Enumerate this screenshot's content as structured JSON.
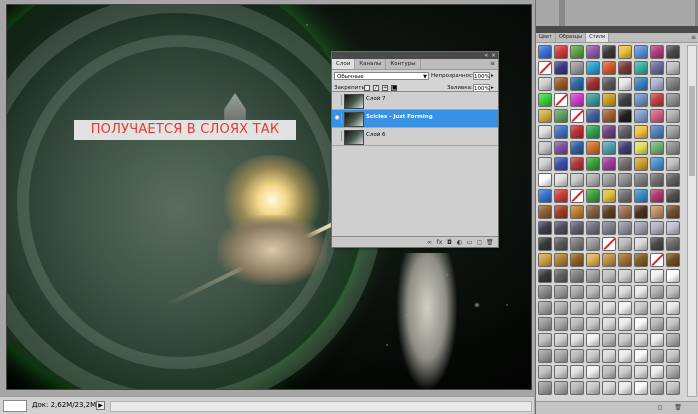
{
  "document": {
    "caption": "ПОЛУЧАЕТСЯ В СЛОЯХ ТАК"
  },
  "status_bar": {
    "doc_size": "Док: 2,62M/23,2M",
    "arrow": "▶"
  },
  "layers_panel": {
    "tabs": [
      {
        "label": "Слои",
        "active": true
      },
      {
        "label": "Каналы",
        "active": false
      },
      {
        "label": "Контуры",
        "active": false
      }
    ],
    "blend_mode": "Обычные",
    "opacity_label": "Непрозрачность:",
    "opacity_value": "100%",
    "lock_label": "Закрепить:",
    "fill_label": "Заливка:",
    "fill_value": "100%",
    "layers": [
      {
        "name": "Слой 7",
        "selected": false,
        "visible": false
      },
      {
        "name": "Scicles - Just Forming",
        "selected": true,
        "visible": true
      },
      {
        "name": "Слой 6",
        "selected": false,
        "visible": false
      }
    ],
    "bottom_icons": [
      "link-icon",
      "fx-icon",
      "mask-icon",
      "adjustment-icon",
      "folder-icon",
      "new-layer-icon",
      "trash-icon"
    ]
  },
  "styles_panel": {
    "tabs": [
      {
        "label": "Цвет",
        "active": false
      },
      {
        "label": "Образцы",
        "active": false
      },
      {
        "label": "Стили",
        "active": true
      }
    ],
    "swatches": [
      "#3a6fd8",
      "#d23a3a",
      "#5fa04a",
      "#8d5aa6",
      "#3a3a3a",
      "#e6c23a",
      "#5a8fd8",
      "#b53a7a",
      "#4a4a4a",
      "#none",
      "#3a3a8a",
      "#9a9a9a",
      "#2aa0d0",
      "#d85a2a",
      "#7a3a3a",
      "#3ab0a0",
      "#6a6a9a",
      "#c0c0c0",
      "#d2d2d2",
      "#9a5a2a",
      "#2a6aa6",
      "#a03030",
      "#5a5a5a",
      "#e8e8e8",
      "#3a80c0",
      "#b0b0d0",
      "#808080",
      "#3ad03a",
      "#none",
      "#d03ad0",
      "#3a9a9a",
      "#c8a020",
      "#404040",
      "#7090c0",
      "#c04040",
      "#909090",
      "#d0b040",
      "#60a060",
      "#none",
      "#4060a0",
      "#a06030",
      "#202020",
      "#80a0d0",
      "#d06080",
      "#b0b0b0",
      "#e0e0e0",
      "#4070c0",
      "#c03030",
      "#30a050",
      "#704080",
      "#606060",
      "#f0c040",
      "#5080c0",
      "#a0a0a0",
      "#c8c8c8",
      "#8050a0",
      "#3060a0",
      "#d07030",
      "#50a0b0",
      "#404070",
      "#e0e060",
      "#70b070",
      "#909090",
      "#d0d0d0",
      "#3a50b0",
      "#b03a3a",
      "#3aa03a",
      "#a03aa0",
      "#707070",
      "#d0a030",
      "#4a90d0",
      "#c0c0c0",
      "#ffffff",
      "#e0e0e0",
      "#c8c8c8",
      "#b0b0b0",
      "#a0a0a0",
      "#909090",
      "#808080",
      "#707070",
      "#606060",
      "#3a70d0",
      "#d03a3a",
      "#none",
      "#3aa03a",
      "#e0c03a",
      "#707070",
      "#3a8ac0",
      "#b03a70",
      "#505050",
      "#906030",
      "#a04020",
      "#c08030",
      "#806040",
      "#604020",
      "#a07050",
      "#503020",
      "#c09060",
      "#705030",
      "#404050",
      "#505060",
      "#606070",
      "#707080",
      "#808090",
      "#9090a0",
      "#a0a0b0",
      "#b0b0c0",
      "#c0c0d0",
      "#3a3a3a",
      "#5a5a5a",
      "#7a7a7a",
      "#9a9a9a",
      "#none",
      "#bababa",
      "#dadada",
      "#4a4a4a",
      "#6a6a6a",
      "#d0a040",
      "#b08030",
      "#906020",
      "#e0b050",
      "#c09040",
      "#a07030",
      "#806020",
      "#none",
      "#705020",
      "#3a3a3a",
      "#606060",
      "#808080",
      "#a0a0a0",
      "#c0c0c0",
      "#d0d0d0",
      "#e0e0e0",
      "#f0f0f0",
      "#ffffff",
      "#8a8a8a",
      "#9a9a9a",
      "#aaaaaa",
      "#bababa",
      "#cacaca",
      "#dadada",
      "#eaeaea",
      "#b0b0b0",
      "#c0c0c0",
      "#a0a0a0",
      "#b0b0b0",
      "#c0c0c0",
      "#d0d0d0",
      "#e0e0e0",
      "#f0f0f0",
      "#c8c8c8",
      "#d8d8d8",
      "#e8e8e8",
      "#9a9a9a",
      "#aaaaaa",
      "#bababa",
      "#cacaca",
      "#dadada",
      "#eaeaea",
      "#fafafa",
      "#b5b5b5",
      "#c5c5c5",
      "#c0c0c0",
      "#d0d0d0",
      "#e0e0e0",
      "#f0f0f0",
      "#bcbcbc",
      "#cccccc",
      "#dcdcdc",
      "#ececec",
      "#acacac",
      "#9a9a9a",
      "#aaaaaa",
      "#bababa",
      "#cacaca",
      "#dadada",
      "#eaeaea",
      "#fafafa",
      "#b5b5b5",
      "#c5c5c5",
      "#c0c0c0",
      "#d0d0d0",
      "#e0e0e0",
      "#f0f0f0",
      "#bcbcbc",
      "#cccccc",
      "#dcdcdc",
      "#ececec",
      "#acacac",
      "#9a9a9a",
      "#aaaaaa",
      "#bababa",
      "#cacaca",
      "#dadada",
      "#eaeaea",
      "#fafafa",
      "#b5b5b5",
      "#c5c5c5"
    ]
  }
}
